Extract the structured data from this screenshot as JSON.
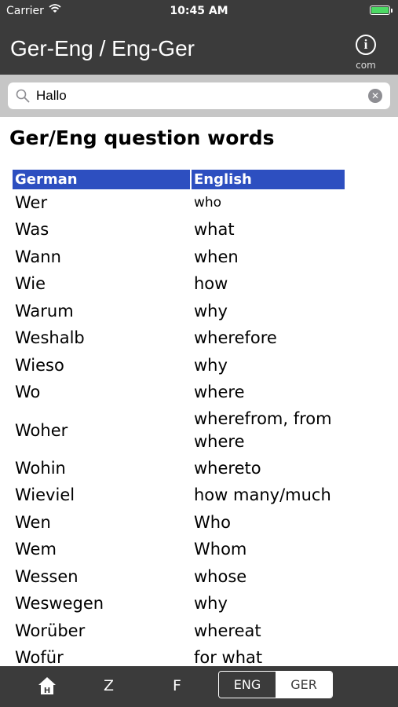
{
  "status_bar": {
    "carrier": "Carrier",
    "time": "10:45 AM"
  },
  "nav": {
    "title": "Ger-Eng / Eng-Ger",
    "info_label": "com"
  },
  "search": {
    "value": "Hallo"
  },
  "page": {
    "heading": "Ger/Eng question words"
  },
  "table": {
    "headers": {
      "german": "German",
      "english": "English"
    },
    "rows": [
      {
        "de": "Wer",
        "en": "who"
      },
      {
        "de": "Was",
        "en": "what"
      },
      {
        "de": "Wann",
        "en": "when"
      },
      {
        "de": "Wie",
        "en": "how"
      },
      {
        "de": "Warum",
        "en": "why"
      },
      {
        "de": "Weshalb",
        "en": "wherefore"
      },
      {
        "de": "Wieso",
        "en": "why"
      },
      {
        "de": "Wo",
        "en": "where"
      },
      {
        "de": "Woher",
        "en": "wherefrom, from where"
      },
      {
        "de": "Wohin",
        "en": "whereto"
      },
      {
        "de": "Wieviel",
        "en": "how many/much"
      },
      {
        "de": "Wen",
        "en": "Who"
      },
      {
        "de": "Wem",
        "en": "Whom"
      },
      {
        "de": "Wessen",
        "en": "whose"
      },
      {
        "de": "Weswegen",
        "en": "why"
      },
      {
        "de": "Worüber",
        "en": "whereat"
      },
      {
        "de": "Wofür",
        "en": "for what"
      }
    ]
  },
  "tab_bar": {
    "z_label": "Z",
    "f_label": "F",
    "eng_label": "ENG",
    "ger_label": "GER",
    "selected_language": "GER"
  },
  "colors": {
    "bar_background": "#3b3b3b",
    "header_blue": "#2d4fc0",
    "battery_green": "#4cd964"
  }
}
